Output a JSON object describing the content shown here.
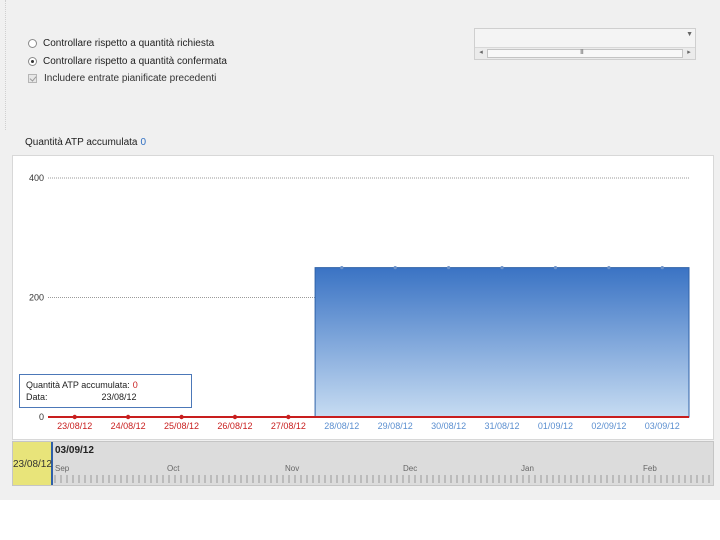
{
  "options": {
    "radio_requested": "Controllare rispetto a quantità richiesta",
    "radio_confirmed": "Controllare rispetto a quantità confermata",
    "checkbox_previous": "Includere entrate pianificate precedenti"
  },
  "scroll": {
    "grip": "III"
  },
  "chart_header": {
    "label": "Quantità ATP accumulata",
    "value": "0"
  },
  "chart_data": {
    "type": "area",
    "categories": [
      "23/08/12",
      "24/08/12",
      "25/08/12",
      "26/08/12",
      "27/08/12",
      "28/08/12",
      "29/08/12",
      "30/08/12",
      "31/08/12",
      "01/09/12",
      "02/09/12",
      "03/09/12"
    ],
    "values": [
      0,
      0,
      0,
      0,
      0,
      250,
      250,
      250,
      250,
      250,
      250,
      250
    ],
    "y_ticks": [
      0,
      200,
      400
    ],
    "ylim": [
      0,
      400
    ],
    "colors": {
      "past": "#c81e1e",
      "future": "#5b8fd0",
      "fill_top": "#3a73c4",
      "fill_bottom": "#c7dcf2"
    }
  },
  "tooltip": {
    "qty_label": "Quantità ATP accumulata:",
    "qty_value": "0",
    "date_label": "Data:",
    "date_value": "23/08/12"
  },
  "navigator": {
    "selected_start": "23/08/12",
    "end_label": "03/09/12",
    "months": [
      "Sep",
      "Oct",
      "Nov",
      "Dec",
      "Jan",
      "Feb"
    ]
  }
}
